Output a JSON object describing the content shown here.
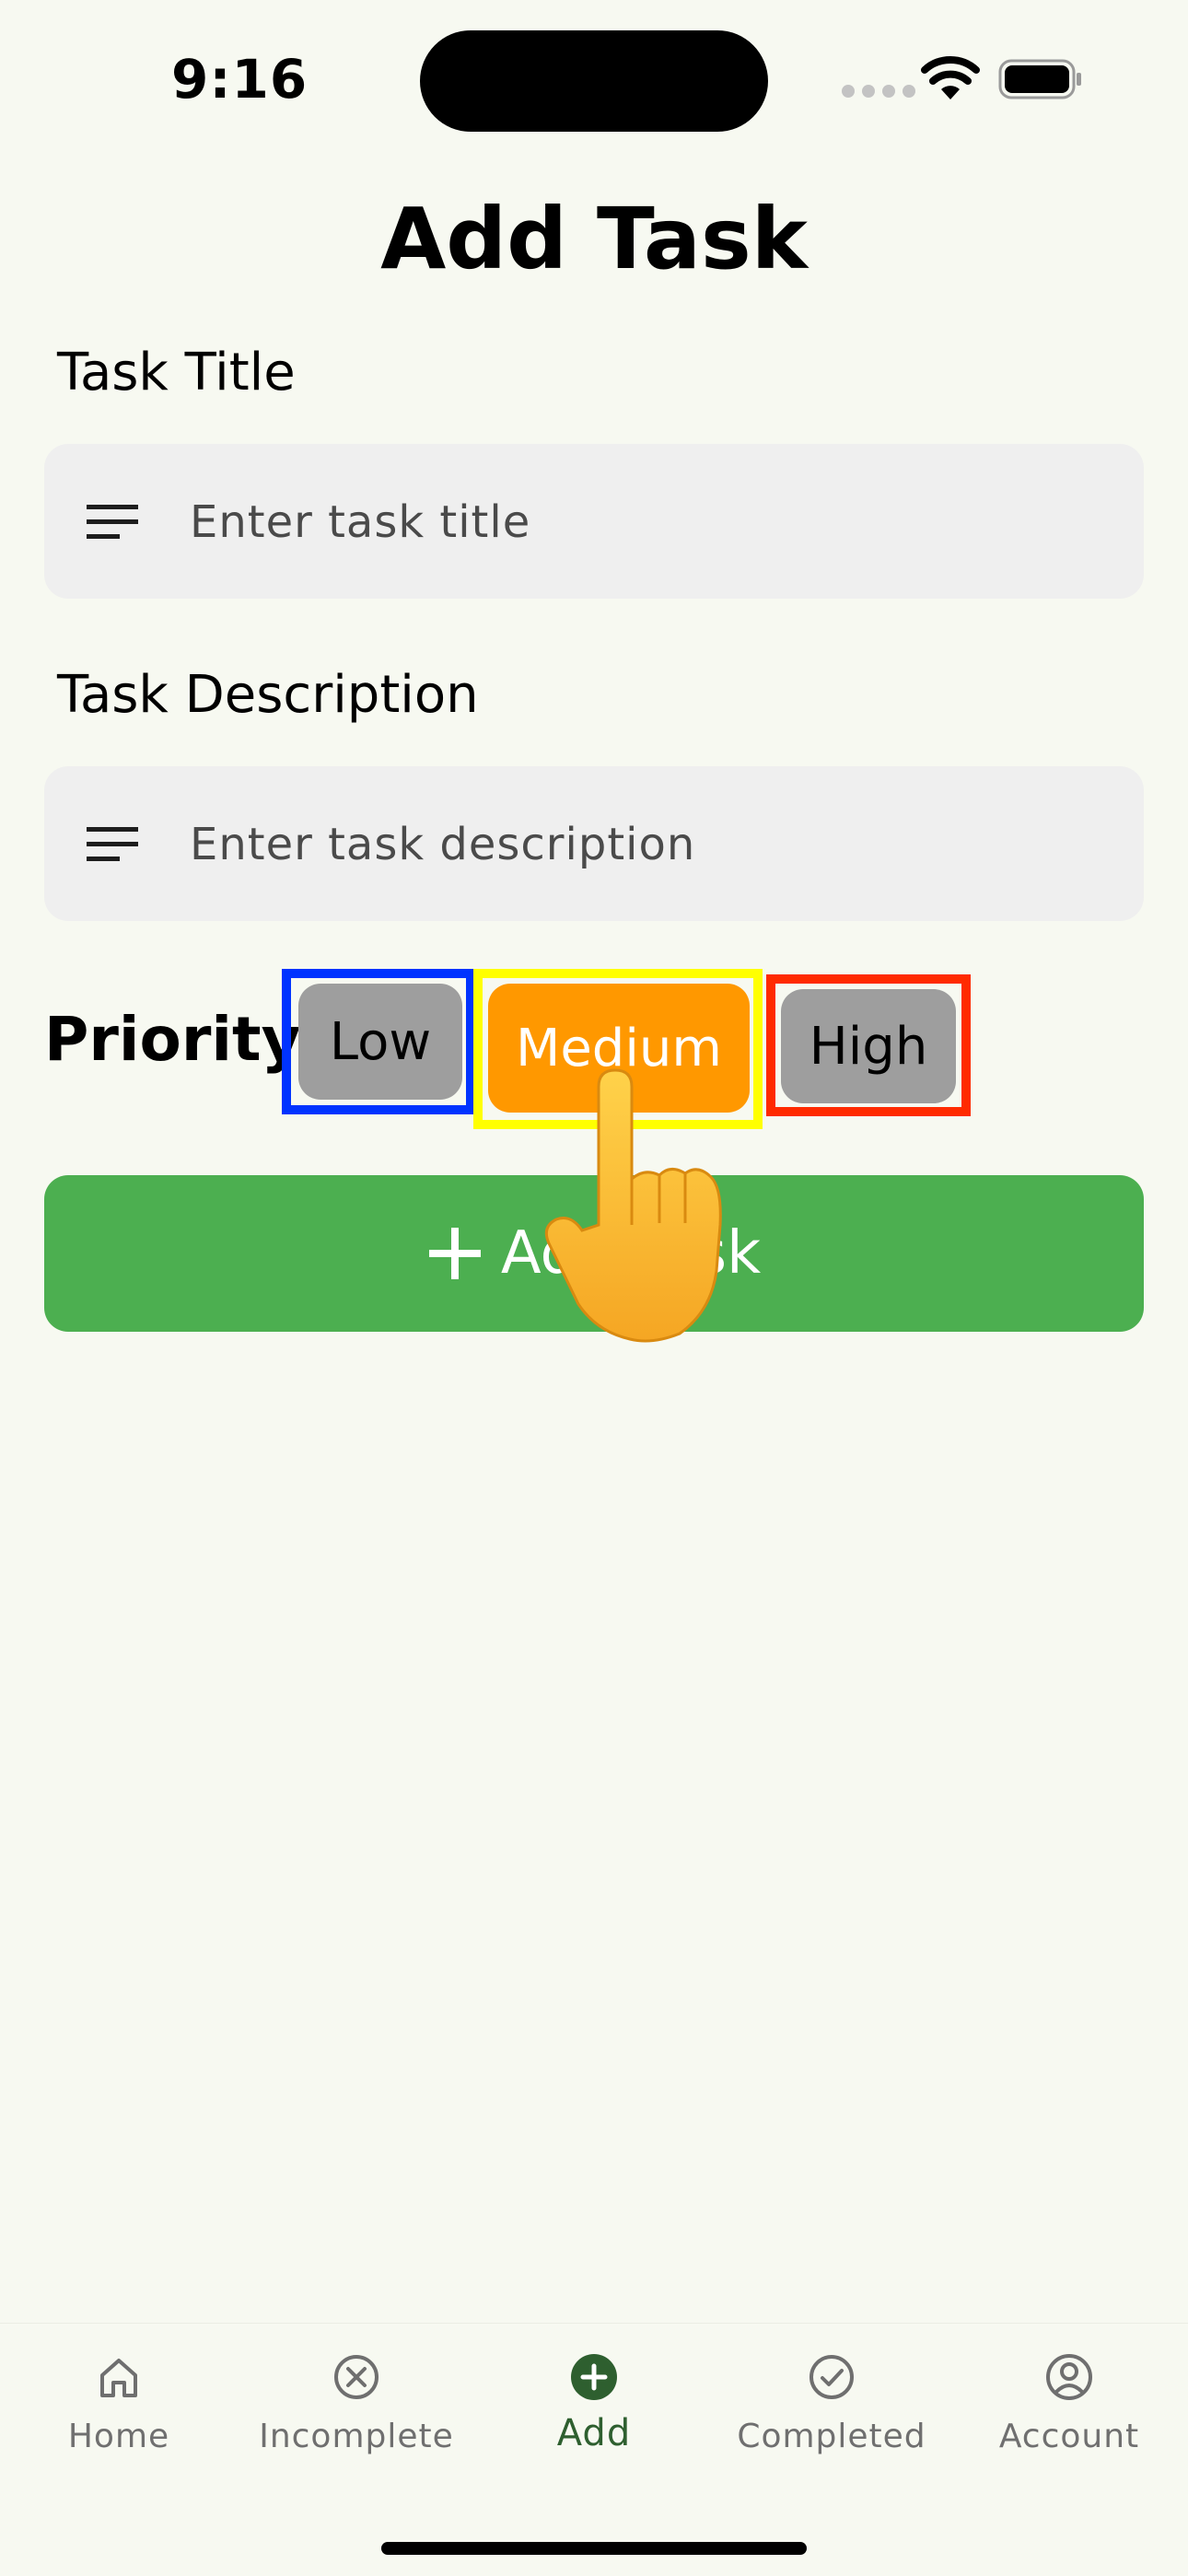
{
  "status_bar": {
    "time": "9:16"
  },
  "page": {
    "title": "Add Task"
  },
  "form": {
    "title_label": "Task Title",
    "title_placeholder": "Enter task title",
    "title_value": "",
    "description_label": "Task Description",
    "description_placeholder": "Enter task description",
    "description_value": ""
  },
  "priority": {
    "label": "Priority",
    "options": [
      {
        "label": "Low",
        "selected": false,
        "outline_color": "#0033ff"
      },
      {
        "label": "Medium",
        "selected": true,
        "color": "#ff9800",
        "outline_color": "#ffff00"
      },
      {
        "label": "High",
        "selected": false,
        "outline_color": "#ff2a00"
      }
    ]
  },
  "add_button": {
    "label": "Add Task",
    "color": "#4caf50"
  },
  "bottom_nav": {
    "items": [
      {
        "label": "Home",
        "icon": "home-icon",
        "active": false
      },
      {
        "label": "Incomplete",
        "icon": "x-circle-icon",
        "active": false
      },
      {
        "label": "Add",
        "icon": "plus-circle-icon",
        "active": true
      },
      {
        "label": "Completed",
        "icon": "check-circle-icon",
        "active": false
      },
      {
        "label": "Account",
        "icon": "account-circle-icon",
        "active": false
      }
    ]
  },
  "overlay": {
    "icon": "pointing-hand-icon"
  }
}
